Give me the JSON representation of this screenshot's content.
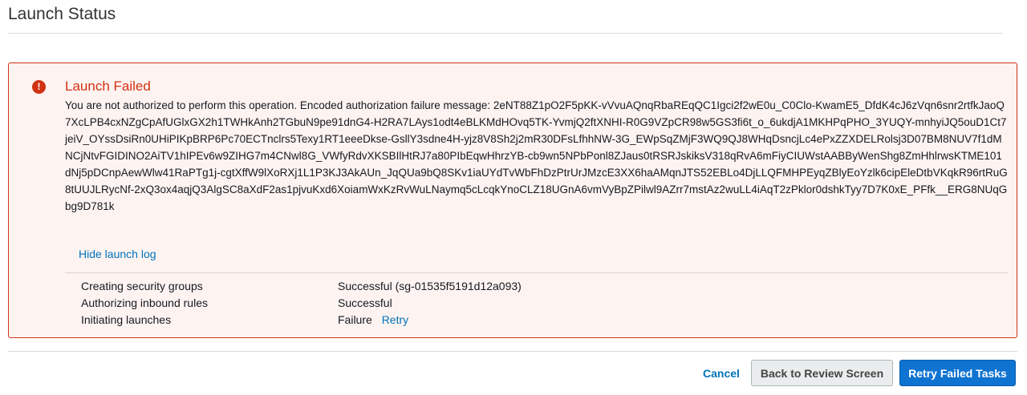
{
  "page": {
    "title": "Launch Status"
  },
  "alert": {
    "icon": "error-icon",
    "icon_glyph": "!",
    "title": "Launch Failed",
    "message": "You are not authorized to perform this operation. Encoded authorization failure message: 2eNT88Z1pO2F5pKK-vVvuAQnqRbaREqQC1Igci2f2wE0u_C0Clo-KwamE5_DfdK4cJ6zVqn6snr2rtfkJaoQ7XcLPB4cxNZgCpAfUGlxGX2h1TWHkAnh2TGbuN9pe91dnG4-H2RA7LAys1odt4eBLKMdHOvq5TK-YvmjQ2ftXNHI-R0G9VZpCR98w5GS3fi6t_o_6ukdjA1MKHPqPHO_3YUQY-mnhyiJQ5ouD1Ct7jeiV_OYssDsiRn0UHiPIKpBRP6Pc70ECTnclrs5Texy1RT1eeeDkse-GsllY3sdne4H-yjz8V8Sh2j2mR30DFsLfhhNW-3G_EWpSqZMjF3WQ9QJ8WHqDsncjLc4ePxZZXDELRolsj3D07BM8NUV7f1dMNCjNtvFGIDINO2AiTV1hIPEv6w9ZIHG7m4CNwl8G_VWfyRdvXKSBIlHtRJ7a80PIbEqwHhrzYB-cb9wn5NPbPonl8ZJaus0tRSRJskiksV318qRvA6mFiyCIUWstAABByWenShg8ZmHhlrwsKTME101dNj5pDCnpAewWlw41RaPTg1j-cgtXffW9lXoRXj1L1P3KJ3AkAUn_JqQUa9bQ8SKv1iaUYdTvWbFhDzPtrUrJMzcE3XX6haAMqnJTS52EBLo4DjLLQFMHPEyqZBlyEoYzlk6cipEleDtbVKqkR96rtRuG8tUUJLRycNf-2xQ3ox4aqjQ3AlgSC8aXdF2as1pjvuKxd6XoiamWxKzRvWuLNaymq5cLcqkYnoCLZ18UGnA6vmVyBpZPilwl9AZrr7mstAz2wuLL4iAqT2zPklor0dshkTyy7D7K0xE_PFfk__ERG8NUqGbg9D781k",
    "hide_log_label": "Hide launch log",
    "log": [
      {
        "task": "Creating security groups",
        "status": "Successful (sg-01535f5191d12a093)"
      },
      {
        "task": "Authorizing inbound rules",
        "status": "Successful"
      },
      {
        "task": "Initiating launches",
        "status": "Failure",
        "action": "Retry"
      }
    ]
  },
  "footer": {
    "cancel_label": "Cancel",
    "back_label": "Back to Review Screen",
    "retry_label": "Retry Failed Tasks"
  },
  "colors": {
    "error": "#d13212",
    "link": "#0073bb",
    "primary_button": "#0f73d1",
    "alert_background": "#fdf3f1"
  }
}
